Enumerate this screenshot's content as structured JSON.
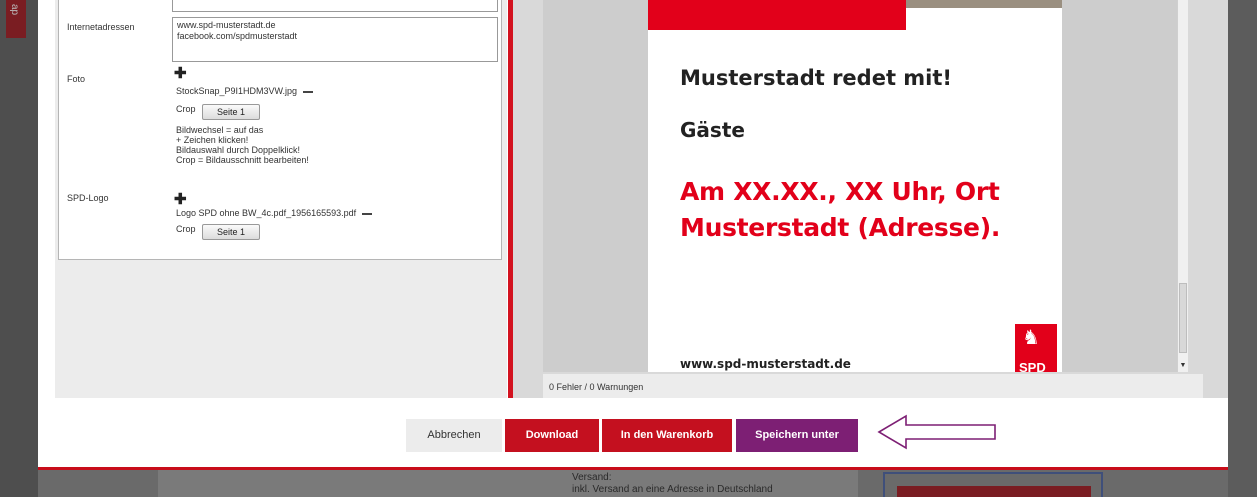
{
  "background": {
    "side_tab_text": "ap",
    "versand_label": "Versand:",
    "versand_detail": "inkl. Versand an eine Adresse in Deutschland"
  },
  "form": {
    "internet_label": "Internetadressen",
    "internet_value_1": "www.spd-musterstadt.de",
    "internet_value_2": "facebook.com/spdmusterstadt",
    "foto_label": "Foto",
    "foto_file": "StockSnap_P9I1HDM3VW.jpg",
    "crop_label": "Crop",
    "seite_btn": "Seite 1",
    "hint_1": "Bildwechsel = auf das",
    "hint_2": "+ Zeichen klicken!",
    "hint_3": "Bildauswahl durch Doppelklick!",
    "hint_4": "Crop = Bildausschnitt bearbeiten!",
    "logo_label": "SPD-Logo",
    "logo_file": "Logo SPD ohne BW_4c.pdf_1956165593.pdf",
    "logo_crop_label": "Crop",
    "logo_seite_btn": "Seite 1"
  },
  "preview": {
    "title": "Musterstadt redet mit!",
    "subtitle": "Gäste",
    "event_line_1": "Am XX.XX., XX Uhr, Ort",
    "event_line_2": "Musterstadt (Adresse).",
    "url": "www.spd-musterstadt.de",
    "logo_text": "SPD",
    "status": "0 Fehler / 0 Warnungen",
    "brand_red": "#e2001a"
  },
  "actions": {
    "cancel": "Abbrechen",
    "download": "Download",
    "cart": "In den Warenkorb",
    "save_as": "Speichern unter",
    "save_color": "#7d1f74",
    "annotation": "arrow-left-outline-icon"
  }
}
